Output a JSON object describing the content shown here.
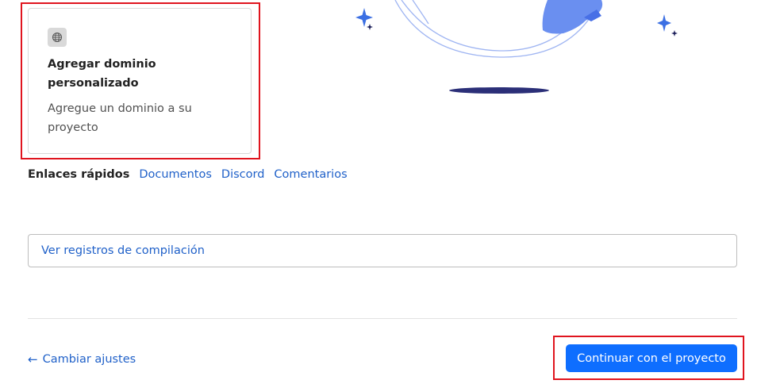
{
  "card": {
    "icon": "globe-icon",
    "title": "Agregar dominio personalizado",
    "description": "Agregue un dominio a su proyecto"
  },
  "quick_links": {
    "label": "Enlaces rápidos",
    "links": [
      "Documentos",
      "Discord",
      "Comentarios"
    ]
  },
  "build_log": {
    "label": "Ver registros de compilación"
  },
  "footer": {
    "back_label": "Cambiar ajustes",
    "continue_label": "Continuar con el proyecto"
  },
  "colors": {
    "link": "#2061c9",
    "primary_button": "#0e6eff",
    "highlight_border": "#e0141e"
  }
}
